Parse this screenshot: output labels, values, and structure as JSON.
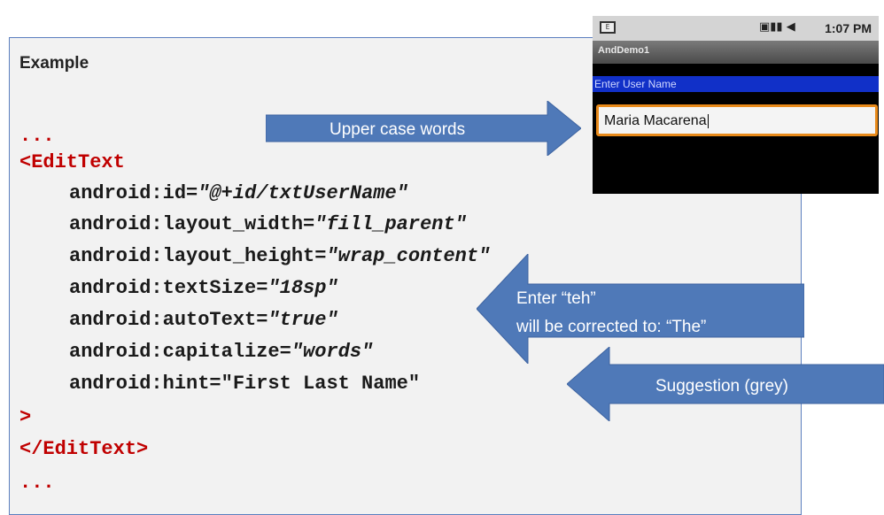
{
  "example": {
    "title": "Example",
    "code": {
      "dots_top": "...",
      "open_tag": "<EditText",
      "attr1_name": "android:id=",
      "attr1_value": "\"@+id/txtUserName\"",
      "attr2_name": "android:layout_width=",
      "attr2_value": "\"fill_parent\"",
      "attr3_name": "android:layout_height=",
      "attr3_value": "\"wrap_content\"",
      "attr4_name": "android:textSize=",
      "attr4_value": "\"18sp\"",
      "attr5_name": "android:autoText=",
      "attr5_value": "\"true\"",
      "attr6_name": "android:capitalize=",
      "attr6_value": "\"words\"",
      "attr7_line": "android:hint=\"First Last Name\"",
      "close_bracket": ">",
      "close_tag": "</EditText>",
      "dots_bottom": "..."
    }
  },
  "phone": {
    "status_left_icon_text": "E",
    "status_icons": "▣▮▮ ◀",
    "status_time": "1:07 PM",
    "app_title": "AndDemo1",
    "hint_label": "Enter User Name",
    "edit_value": "Maria Macarena"
  },
  "callouts": {
    "upper_case": "Upper case words",
    "autotext_line1": "Enter  “teh”",
    "autotext_line2": "will be corrected to: “The”",
    "suggestion": "Suggestion (grey)"
  },
  "colors": {
    "arrow_fill": "#4f79b8",
    "code_red": "#c00000",
    "box_border": "#5b7fbf",
    "edit_border": "#e88a1a",
    "hint_bar": "#1130c8"
  },
  "icons": [
    "arrow-right-icon",
    "arrow-left-icon",
    "sim-card-icon",
    "signal-bars-icon",
    "battery-icon"
  ]
}
